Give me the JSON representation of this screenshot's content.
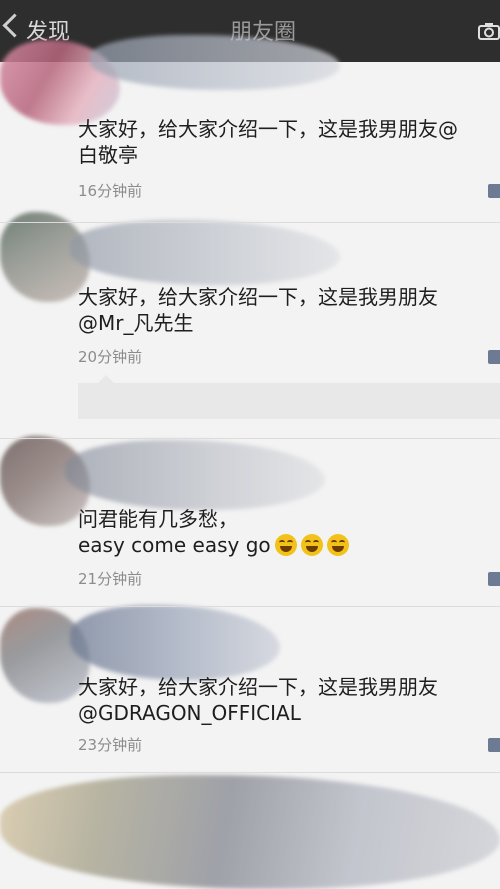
{
  "topbar": {
    "back_label": "发现",
    "title": "朋友圈"
  },
  "posts": [
    {
      "line1": "大家好，给大家介绍一下，这是我男朋友@",
      "line2": "白敬亭",
      "time": "16分钟前"
    },
    {
      "line1": "大家好，给大家介绍一下，这是我男朋友",
      "line2": "@Mr_凡先生",
      "time": "20分钟前"
    },
    {
      "line1": "问君能有几多愁，",
      "line2": "easy come easy go",
      "time": "21分钟前"
    },
    {
      "line1": "大家好，给大家介绍一下，这是我男朋友",
      "line2": "@GDRAGON_OFFICIAL",
      "time": "23分钟前"
    }
  ],
  "icons": {
    "back": "chevron-left-icon",
    "camera": "camera-icon",
    "emoji": "laugh-cry-emoji-icon",
    "more": "more-options-icon"
  }
}
